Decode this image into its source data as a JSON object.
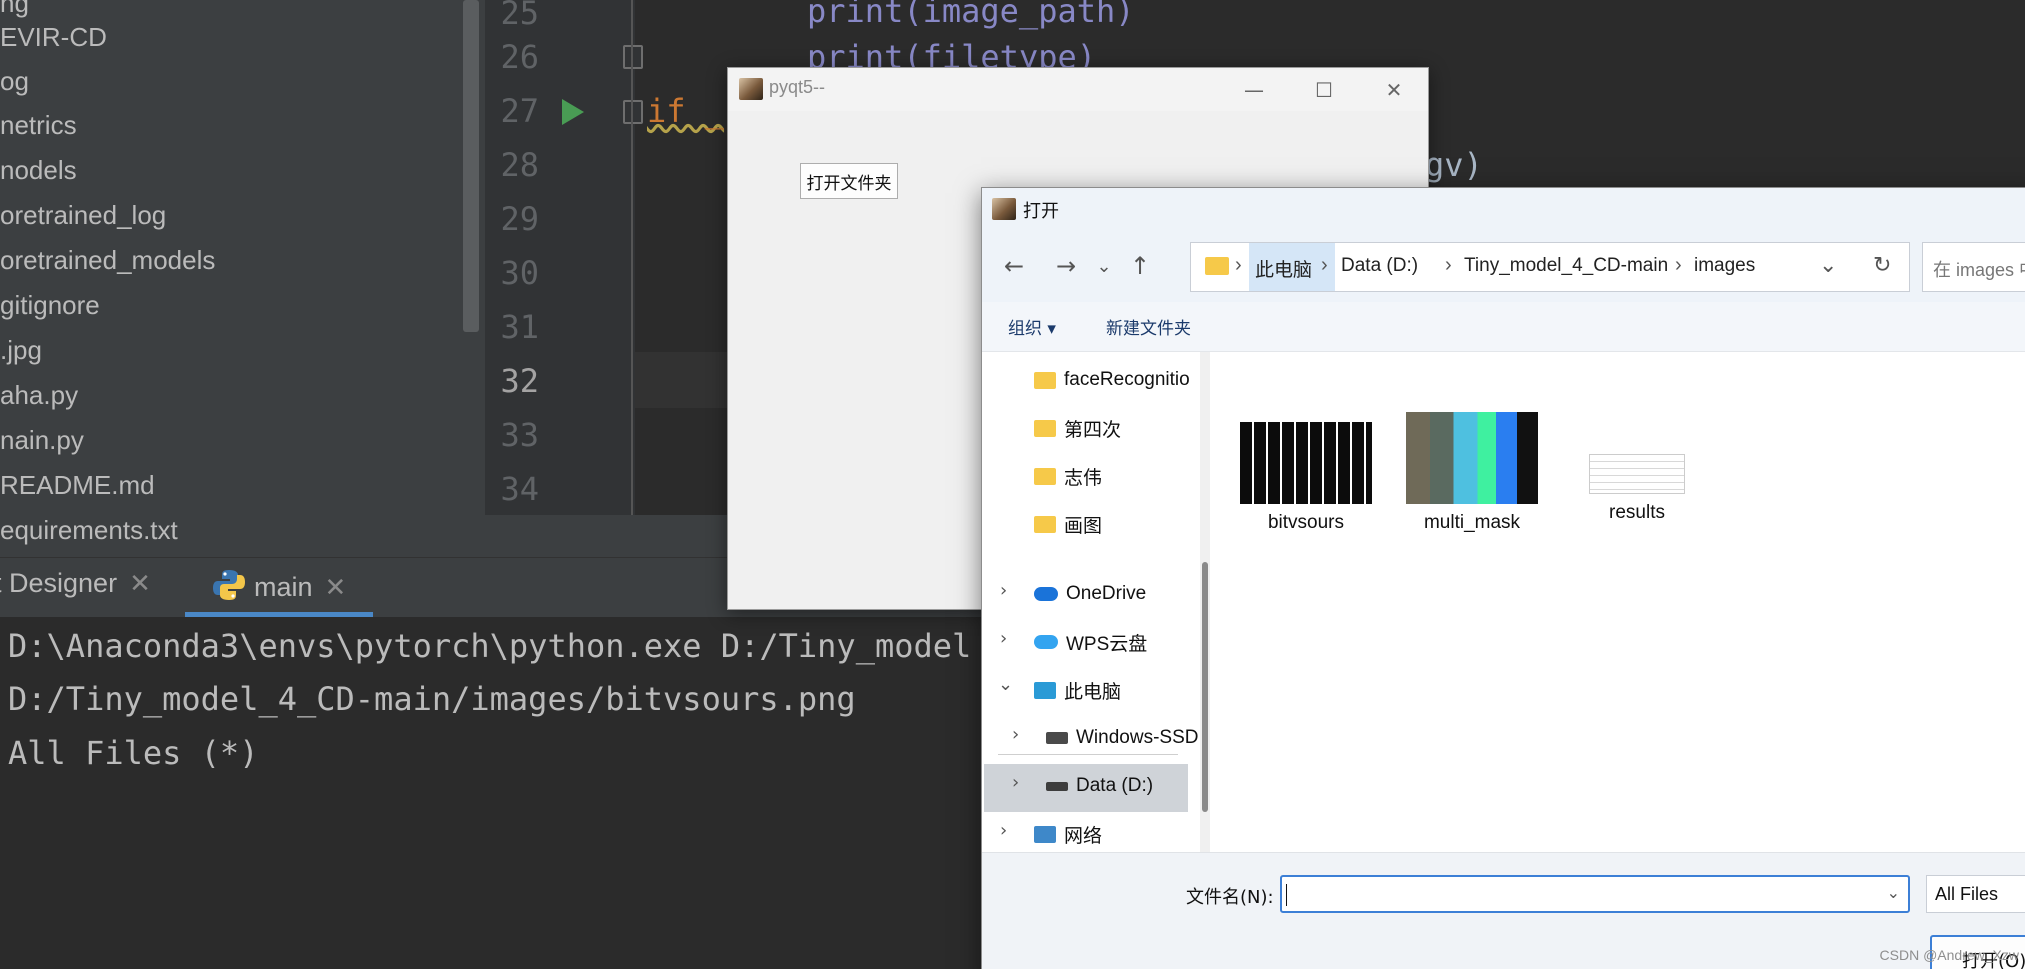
{
  "project_tree": {
    "items": [
      "ng",
      "EVIR-CD",
      "og",
      "netrics",
      "nodels",
      "oretrained_log",
      "oretrained_models",
      "gitignore",
      ".jpg",
      "aha.py",
      "nain.py",
      "README.md",
      "equirements.txt"
    ]
  },
  "editor": {
    "line_numbers": [
      "25",
      "26",
      "27",
      "28",
      "29",
      "30",
      "31",
      "32",
      "33",
      "34"
    ],
    "current_line": "32",
    "code": {
      "line25": "print(image_path)",
      "line26": "print(filetype)",
      "line27_kw": "if _",
      "line28_tail": "gv)"
    }
  },
  "run_panel": {
    "tabs": [
      {
        "label": "Qt Designer",
        "visible": "t Designer"
      },
      {
        "label": "main"
      }
    ],
    "console_lines": [
      "D:\\Anaconda3\\envs\\pytorch\\python.exe D:/Tiny_model",
      "D:/Tiny_model_4_CD-main/images/bitvsours.png",
      "All Files (*)"
    ]
  },
  "pyqt_window": {
    "title": "pyqt5--",
    "open_folder_label": "打开文件夹",
    "controls": {
      "minimize": "—",
      "maximize": "☐",
      "close": "✕"
    }
  },
  "open_dialog": {
    "title": "打开",
    "breadcrumbs": [
      "此电脑",
      "Data (D:)",
      "Tiny_model_4_CD-main",
      "images"
    ],
    "search_placeholder": "在 images 中",
    "toolbar": {
      "organize": "组织 ▾",
      "new_folder": "新建文件夹"
    },
    "nav_items": [
      {
        "label": "faceRecognitio",
        "type": "folder"
      },
      {
        "label": "第四次",
        "type": "folder"
      },
      {
        "label": "志伟",
        "type": "folder"
      },
      {
        "label": "画图",
        "type": "folder"
      },
      {
        "label": "OneDrive",
        "type": "cloud"
      },
      {
        "label": "WPS云盘",
        "type": "cloud"
      },
      {
        "label": "此电脑",
        "type": "pc",
        "expanded": true
      },
      {
        "label": "Windows-SSD",
        "type": "drive"
      },
      {
        "label": "Data (D:)",
        "type": "drive",
        "selected": true
      },
      {
        "label": "网络",
        "type": "network"
      }
    ],
    "files": [
      {
        "name": "bitvsours"
      },
      {
        "name": "multi_mask"
      },
      {
        "name": "results"
      }
    ],
    "filename_label": "文件名(N):",
    "filename_value": "",
    "filetype": "All Files",
    "open_button": "打开(O)"
  },
  "watermark": "CSDN @Andrew_Xzw",
  "colors": {
    "ide_bg": "#2b2b2b",
    "ide_panel": "#3c3f41",
    "keyword_orange": "#cc7832",
    "builtin_purple": "#8888c6",
    "run_green": "#499c54",
    "accent_blue": "#3c7fd6"
  }
}
